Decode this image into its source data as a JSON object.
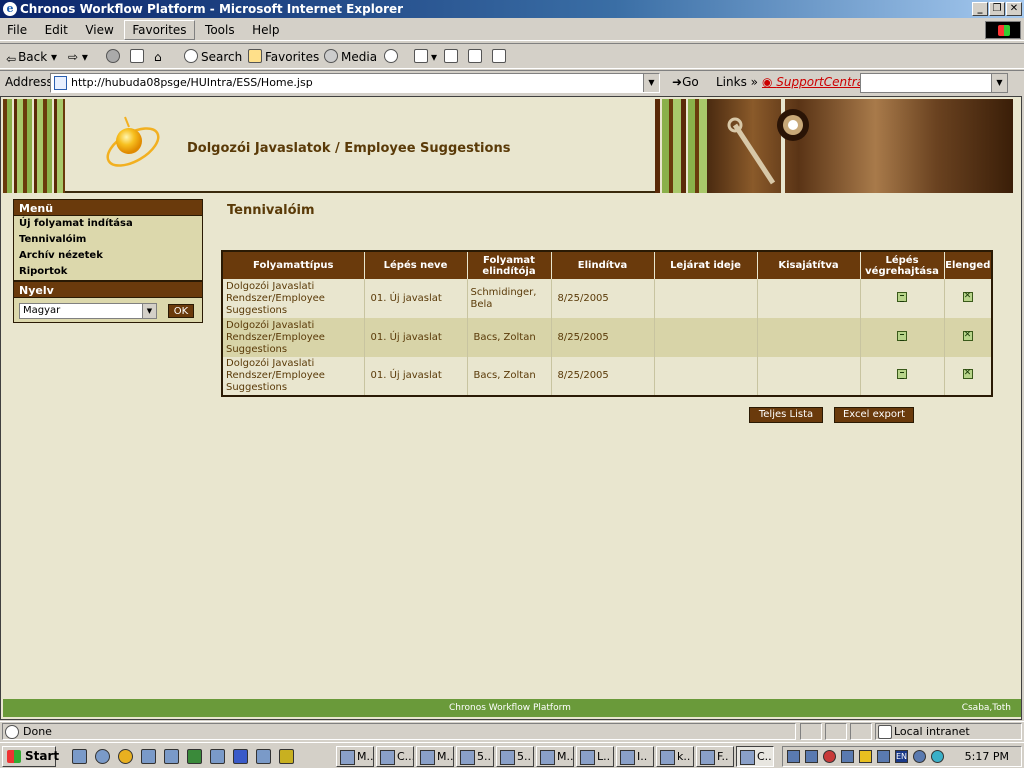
{
  "window": {
    "title": "Chronos Workflow Platform - Microsoft Internet Explorer"
  },
  "menubar": [
    "File",
    "Edit",
    "View",
    "Favorites",
    "Tools",
    "Help"
  ],
  "toolbar": {
    "back": "Back",
    "search": "Search",
    "favorites": "Favorites",
    "media": "Media"
  },
  "address": {
    "label": "Address",
    "url": "http://hubuda08psge/HUIntra/ESS/Home.jsp",
    "go": "Go",
    "links": "Links",
    "support": "SupportCentral"
  },
  "app": {
    "title": "Dolgozói Javaslatok / Employee Suggestions"
  },
  "sidebar": {
    "menu_title": "Menü",
    "items": [
      "Új folyamat indítása",
      "Tennivalóim",
      "Archív nézetek",
      "Riportok"
    ],
    "lang_title": "Nyelv",
    "lang_value": "Magyar",
    "ok": "OK"
  },
  "main": {
    "heading": "Tennivalóim",
    "columns": [
      "Folyamattípus",
      "Lépés neve",
      "Folyamat elindítója",
      "Elindítva",
      "Lejárat ideje",
      "Kisajátítva",
      "Lépés végrehajtása",
      "Elenged"
    ],
    "rows": [
      {
        "type": "Dolgozói Javaslati Rendszer/Employee Suggestions",
        "step": "01. Új javaslat",
        "initiator": "Schmidinger, Bela",
        "started": "8/25/2005",
        "due": "",
        "claimed": ""
      },
      {
        "type": "Dolgozói Javaslati Rendszer/Employee Suggestions",
        "step": "01. Új javaslat",
        "initiator": "Bacs, Zoltan",
        "started": "8/25/2005",
        "due": "",
        "claimed": ""
      },
      {
        "type": "Dolgozói Javaslati Rendszer/Employee Suggestions",
        "step": "01. Új javaslat",
        "initiator": "Bacs, Zoltan",
        "started": "8/25/2005",
        "due": "",
        "claimed": ""
      }
    ],
    "buttons": {
      "full_list": "Teljes Lista",
      "excel": "Excel export"
    }
  },
  "footer": {
    "center": "Chronos Workflow Platform",
    "user": "Csaba,Toth"
  },
  "status": {
    "text": "Done",
    "zone": "Local intranet"
  },
  "taskbar": {
    "start": "Start",
    "tasks": [
      "M..",
      "C...",
      "M..",
      "5..",
      "5..",
      "M..",
      "L..",
      "I..",
      "k..",
      "F..",
      "C.."
    ],
    "lang": "EN",
    "clock": "5:17 PM"
  }
}
